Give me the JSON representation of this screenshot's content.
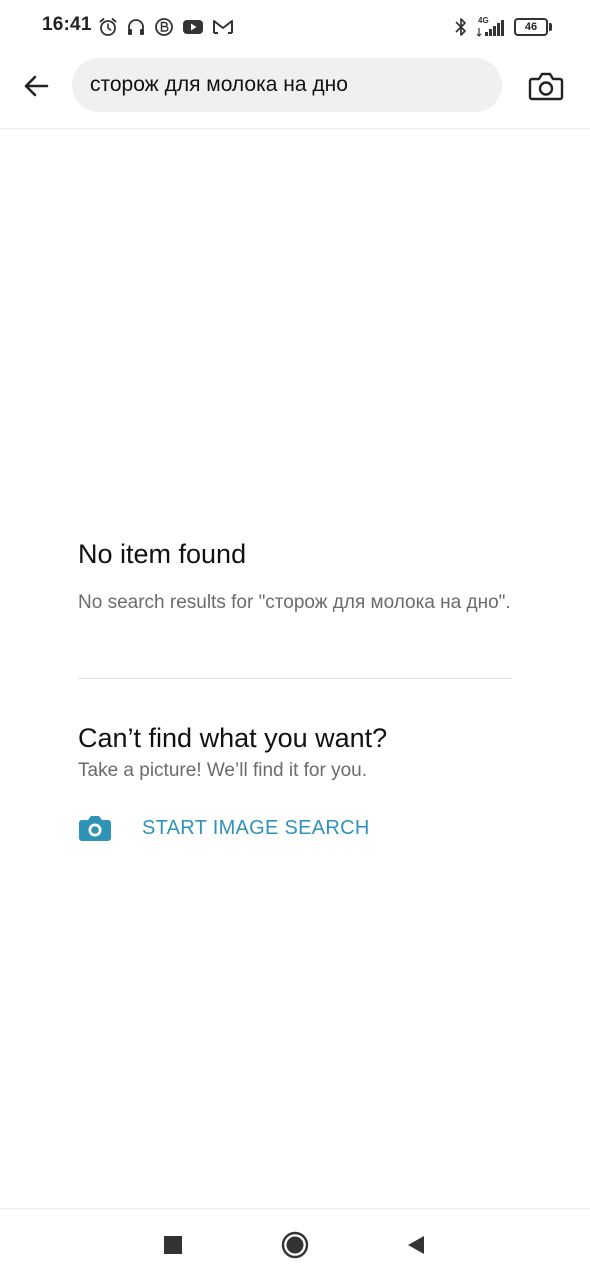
{
  "status_bar": {
    "time": "16:41",
    "left_icons": [
      "alarm-icon",
      "headphones-icon",
      "b-badge-icon",
      "youtube-icon",
      "mail-icon"
    ],
    "network": "4G",
    "battery": "46"
  },
  "search": {
    "query": "сторож для молока на дно"
  },
  "empty_state": {
    "title": "No item found",
    "message": "No search results for \"сторож для молока на дно\"."
  },
  "image_search_promo": {
    "title": "Can’t find what you want?",
    "subtitle": "Take a picture! We’ll find it for you.",
    "button_label": "START IMAGE SEARCH"
  },
  "colors": {
    "accent": "#2f93b8",
    "search_field_bg": "#f0f0f0",
    "secondary_text": "#6b6b6b"
  },
  "nav_bar": {
    "buttons": [
      "recent-apps-icon",
      "home-icon",
      "back-triangle-icon"
    ]
  }
}
